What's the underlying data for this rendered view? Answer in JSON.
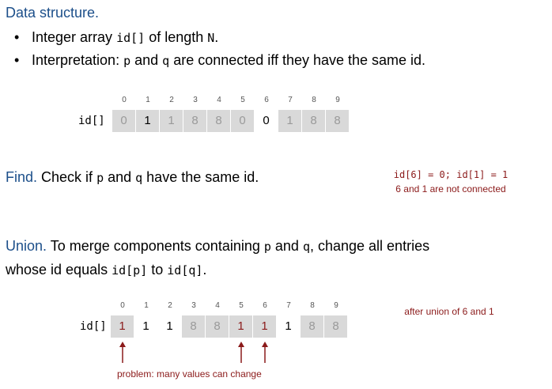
{
  "data_structure": {
    "heading": "Data structure.",
    "bullet1": {
      "text": "Integer array ",
      "code1": "id[]",
      "text2": " of length ",
      "code2": "N",
      "text3": "."
    },
    "bullet2": {
      "text": "Interpretation:  ",
      "code1": "p",
      "text2": " and ",
      "code2": "q",
      "text3": " are connected iff they have the same id."
    }
  },
  "array1": {
    "label": "id[]",
    "indices": [
      "0",
      "1",
      "2",
      "3",
      "4",
      "5",
      "6",
      "7",
      "8",
      "9"
    ],
    "values": [
      "0",
      "1",
      "1",
      "8",
      "8",
      "0",
      "0",
      "1",
      "8",
      "8"
    ]
  },
  "find": {
    "heading": "Find.",
    "text1": "  Check if ",
    "code1": "p",
    "text2": " and ",
    "code2": "q",
    "text3": " have the same id.",
    "note_line1": "id[6] = 0; id[1] = 1",
    "note_line2": "6 and 1 are not connected"
  },
  "union": {
    "heading": "Union.",
    "line1_text1": "  To merge components containing ",
    "line1_code1": "p",
    "line1_text2": " and ",
    "line1_code2": "q",
    "line1_text3": ", change all entries",
    "line2_text1": "whose id equals ",
    "line2_code1": "id[p]",
    "line2_text2": " to ",
    "line2_code2": "id[q]",
    "line2_text3": "."
  },
  "array2": {
    "label": "id[]",
    "indices": [
      "0",
      "1",
      "2",
      "3",
      "4",
      "5",
      "6",
      "7",
      "8",
      "9"
    ],
    "values": [
      "1",
      "1",
      "1",
      "8",
      "8",
      "1",
      "1",
      "1",
      "8",
      "8"
    ],
    "note": "after union of 6 and 1",
    "problem_note": "problem: many values can change"
  },
  "colors": {
    "blue": "#1c4f8a",
    "red": "#8b1a1a",
    "cell": "#d9d9d9"
  }
}
